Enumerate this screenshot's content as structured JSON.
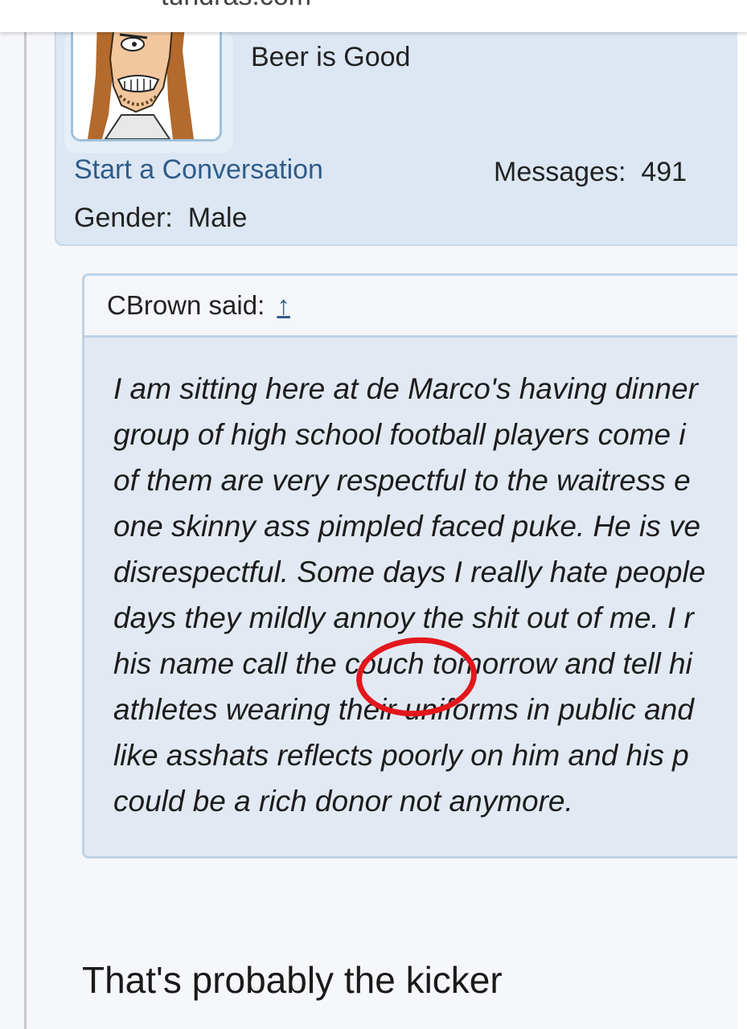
{
  "browser": {
    "url": "tundras.com"
  },
  "user_panel": {
    "title": "Beer is Good",
    "start_conversation": "Start a Conversation",
    "messages_label": "Messages:",
    "messages_count": "491",
    "gender_label": "Gender:",
    "gender_value": "Male"
  },
  "quote": {
    "author": "CBrown said:",
    "arrow": "↑",
    "lines": [
      "I am sitting here at de Marco's having dinner",
      "group of high school football players come i",
      "of them are very respectful to the waitress e",
      "one skinny ass pimpled faced puke. He is ve",
      "disrespectful. Some days I really hate people",
      "days they mildly annoy the shit out of me. I r",
      "his name call the couch tomorrow and tell hi",
      "athletes wearing their uniforms in public and",
      "like asshats reflects poorly on him and his p",
      "could be a rich donor not anymore."
    ],
    "highlighted_word": "couch",
    "highlight_color": "#e3161c"
  },
  "reply": {
    "text": "That's probably the kicker"
  },
  "colors": {
    "panel_bg": "#dce7f3",
    "link": "#2f5c8a",
    "quote_bg": "#e2e9f3"
  }
}
